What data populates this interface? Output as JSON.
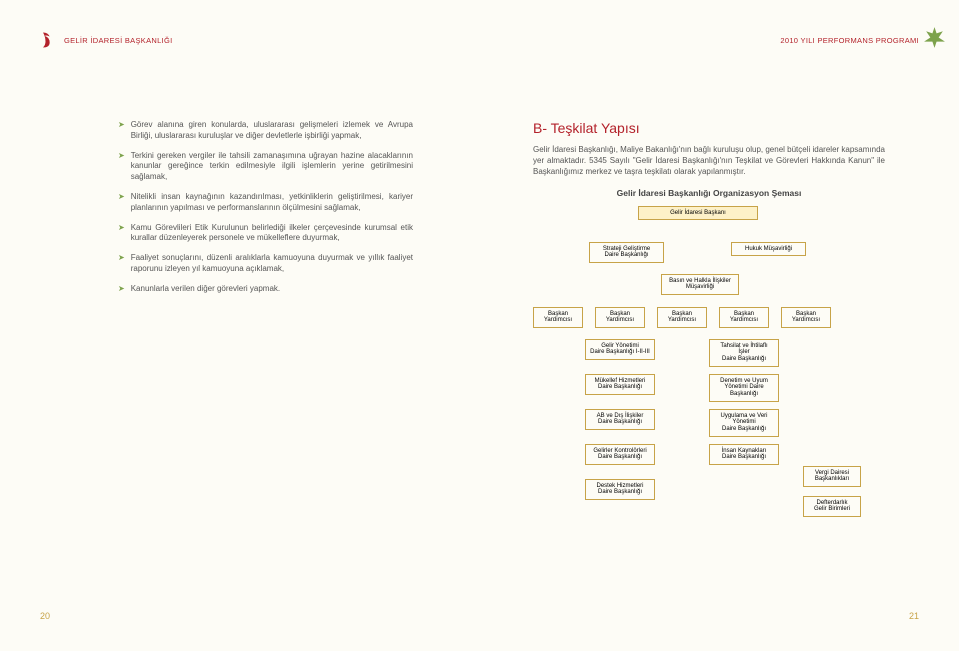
{
  "header": {
    "brand": "GELİR İDARESİ BAŞKANLIĞI",
    "program": "2010 YILI PERFORMANS PROGRAMI"
  },
  "left": {
    "bullets": [
      "Görev alanına giren konularda, uluslararası gelişmeleri izlemek ve Avrupa Birliği, uluslararası kuruluşlar ve diğer devletlerle işbirliği yapmak,",
      "Terkini gereken vergiler ile tahsili zamanaşımına uğrayan hazine alacaklarının kanunlar gereğince terkin edilmesiyle ilgili işlemlerin yerine getirilmesini sağlamak,",
      "Nitelikli insan kaynağının kazandırılması, yetkinliklerin geliştirilmesi, kariyer planlarının yapılması ve performanslarının ölçülmesini sağlamak,",
      "Kamu Görevlileri Etik Kurulunun belirlediği ilkeler çerçevesinde kurumsal etik kurallar düzenleyerek personele ve mükelleflere duyurmak,",
      "Faaliyet sonuçlarını, düzenli aralıklarla kamuoyuna duyurmak ve yıllık faaliyet raporunu izleyen yıl kamuoyuna açıklamak,",
      "Kanunlarla verilen diğer görevleri yapmak."
    ]
  },
  "right": {
    "heading": "B- Teşkilat Yapısı",
    "body": "Gelir İdaresi Başkanlığı, Maliye Bakanlığı'nın bağlı kuruluşu olup, genel bütçeli idareler kapsamında yer almaktadır. 5345 Sayılı \"Gelir İdaresi Başkanlığı'nın Teşkilat ve Görevleri Hakkında Kanun\" ile Başkanlığımız merkez ve taşra teşkilatı olarak yapılanmıştır.",
    "chart_title": "Gelir İdaresi Başkanlığı Organizasyon Şeması"
  },
  "org": {
    "root": "Gelir İdaresi Başkanı",
    "staff_left": "Strateji Geliştirme\nDaire Başkanlığı",
    "staff_right": "Hukuk Müşavirliği",
    "staff_center": "Basın ve Halkla İlişkiler\nMüşavirliği",
    "yardimci": "Başkan\nYardımcısı",
    "col2": [
      "Gelir Yönetimi\nDaire Başkanlığı I-II-III",
      "Mükellef Hizmetleri\nDaire Başkanlığı",
      "AB ve Dış İlişkiler\nDaire Başkanlığı",
      "Gelirler Kontrolörleri\nDaire Başkanlığı",
      "Destek Hizmetleri\nDaire Başkanlığı"
    ],
    "col4": [
      "Tahsilat ve İhtilaflı İşler\nDaire Başkanlığı",
      "Denetim ve Uyum\nYönetimi Daire Başkanlığı",
      "Uygulama ve Veri Yönetimi\nDaire Başkanlığı",
      "İnsan Kaynakları\nDaire Başkanlığı"
    ],
    "side": [
      "Vergi Dairesi\nBaşkanlıkları",
      "Defterdarlık\nGelir Birimleri"
    ]
  },
  "pages": {
    "left": "20",
    "right": "21"
  }
}
